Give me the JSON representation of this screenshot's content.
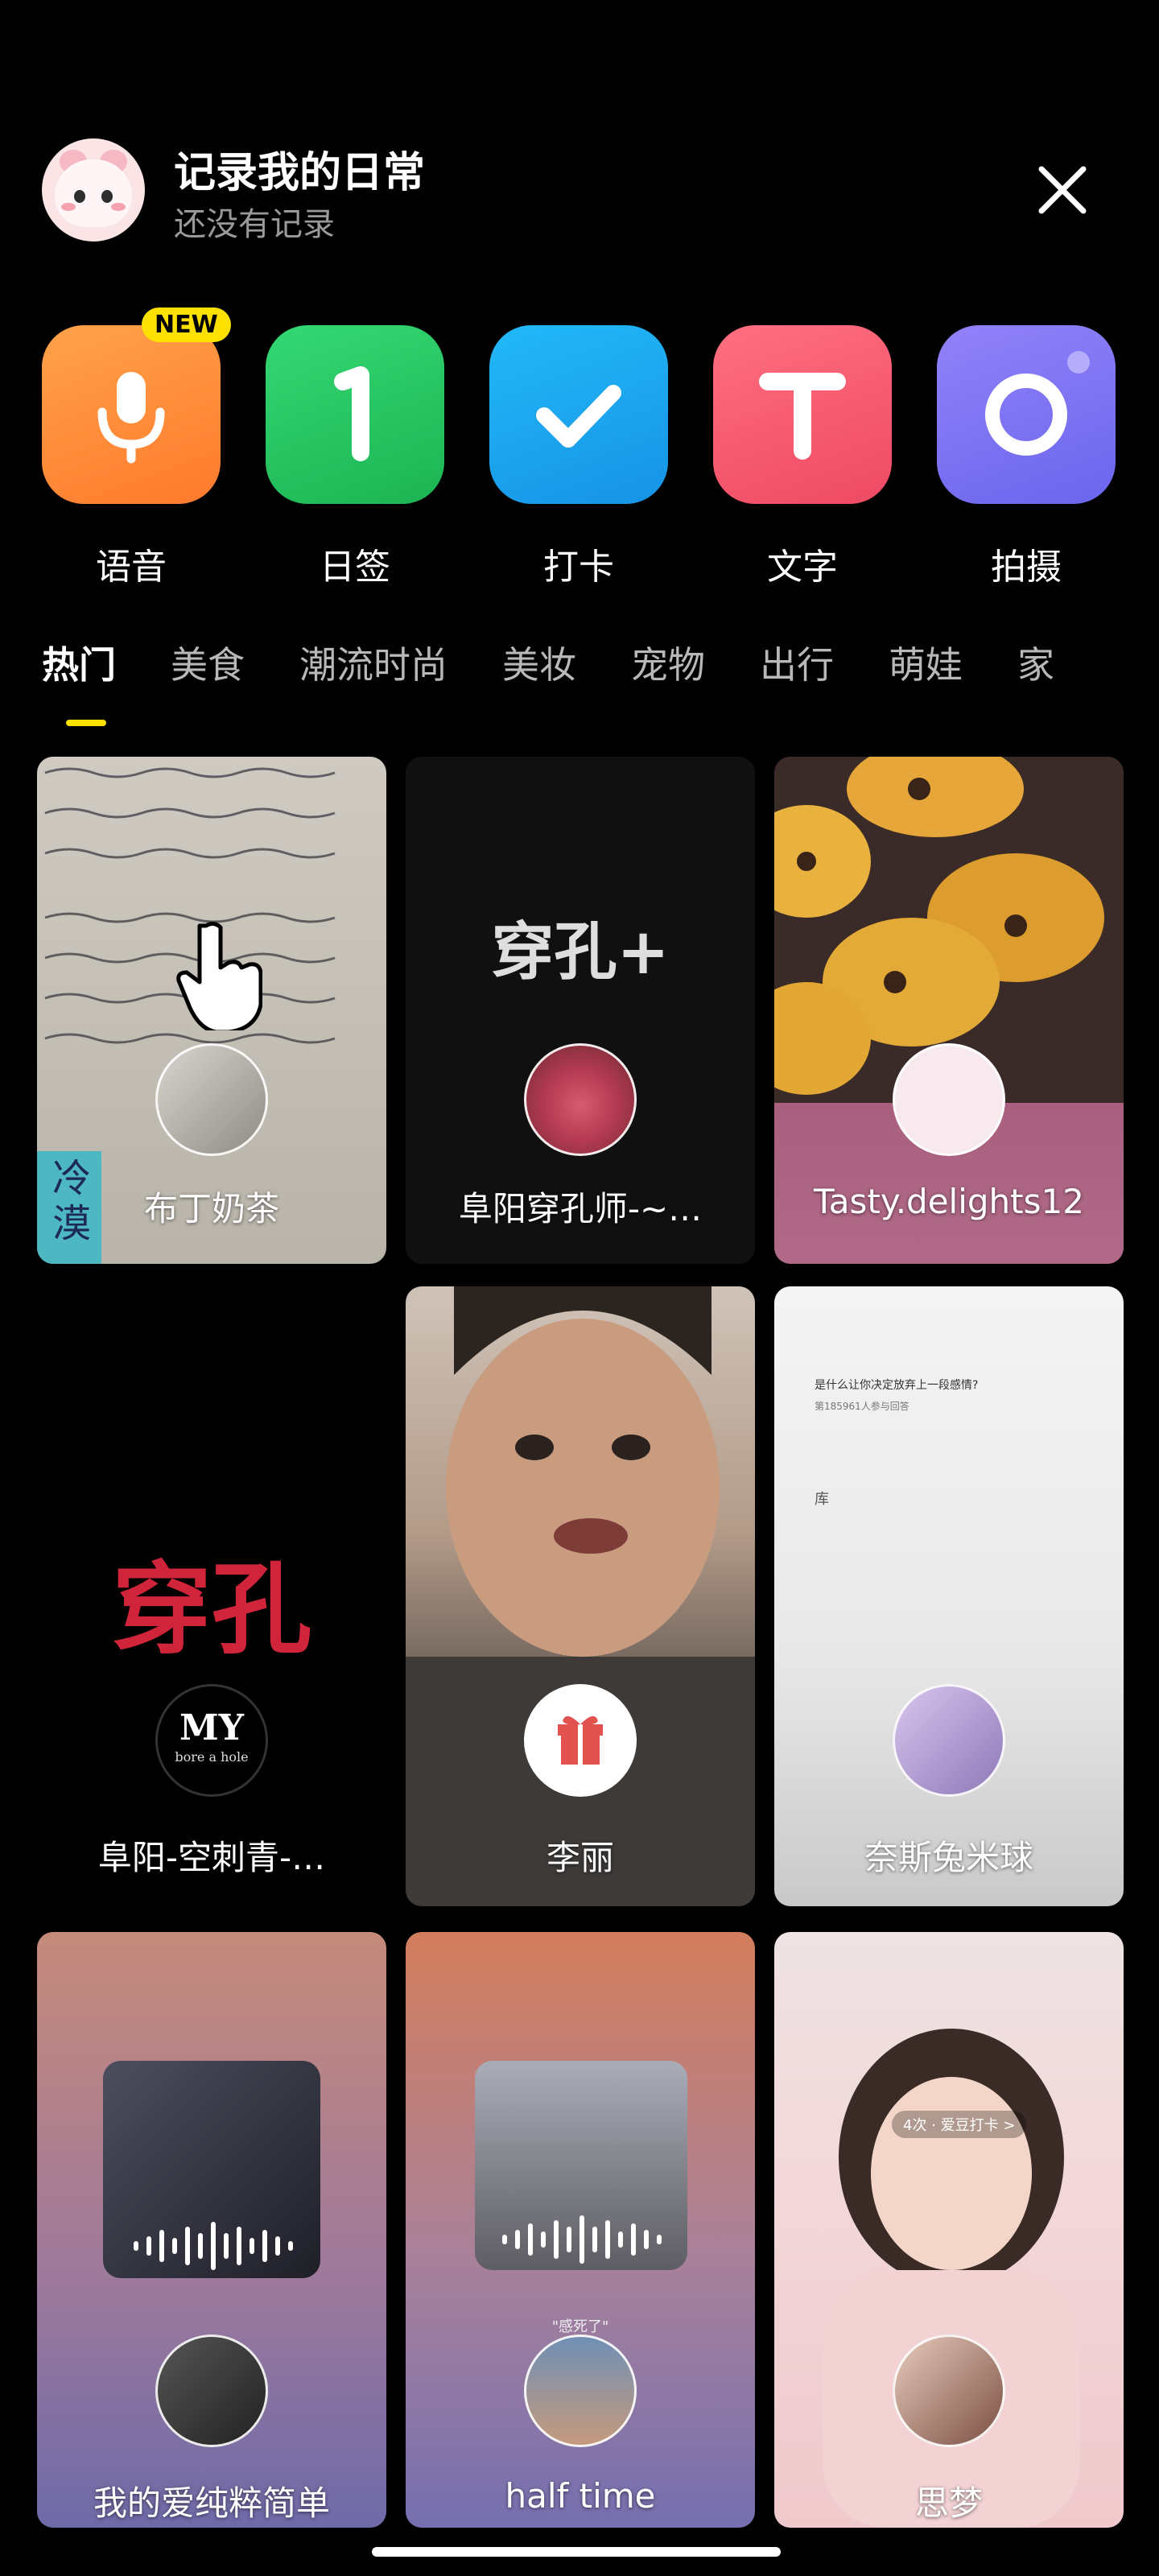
{
  "header": {
    "title": "记录我的日常",
    "subtitle": "还没有记录",
    "avatar_icon": "bunny-avatar-icon",
    "close_icon": "close-icon"
  },
  "actions": [
    {
      "label": "语音",
      "icon": "microphone-icon",
      "color_from": "#ff9a3c",
      "color_to": "#ff7b2e",
      "badge": "NEW"
    },
    {
      "label": "日签",
      "icon": "number-one-icon",
      "color_from": "#2fd06d",
      "color_to": "#1fb855",
      "badge": ""
    },
    {
      "label": "打卡",
      "icon": "checkmark-icon",
      "color_from": "#1fb3f5",
      "color_to": "#1a96ea",
      "badge": ""
    },
    {
      "label": "文字",
      "icon": "text-t-icon",
      "color_from": "#ff6b7d",
      "color_to": "#f14f67",
      "badge": ""
    },
    {
      "label": "拍摄",
      "icon": "camera-lens-icon",
      "color_from": "#8c7cf6",
      "color_to": "#6e68f0",
      "badge": ""
    }
  ],
  "tabs": [
    "热门",
    "美食",
    "潮流时尚",
    "美妆",
    "宠物",
    "出行",
    "萌娃",
    "家"
  ],
  "active_tab": "热门",
  "feed": [
    {
      "name": "布丁奶茶",
      "overlay_text": "冷漠"
    },
    {
      "name": "阜阳穿孔师-~…",
      "overlay_text": "穿孔+"
    },
    {
      "name": "Tasty.delights12",
      "overlay_text": ""
    },
    {
      "name": "阜阳-空刺青-…",
      "overlay_text": "穿孔",
      "logo_text": "MY",
      "logo_sub": "bore a hole"
    },
    {
      "name": "李丽",
      "overlay_text": ""
    },
    {
      "name": "奈斯兔米球",
      "overlay_text": "是什么让你决定放弃上一段感情?",
      "overlay_sub": "第185961人参与回答",
      "overlay_char": "库"
    },
    {
      "name": "我的爱纯粹简单",
      "overlay_text": ""
    },
    {
      "name": "half time",
      "overlay_text": "\"感死了\""
    },
    {
      "name": "思梦",
      "overlay_text": "4次 · 爱豆打卡 >"
    }
  ],
  "colors": {
    "accent": "#ffe100",
    "background": "#000000"
  }
}
